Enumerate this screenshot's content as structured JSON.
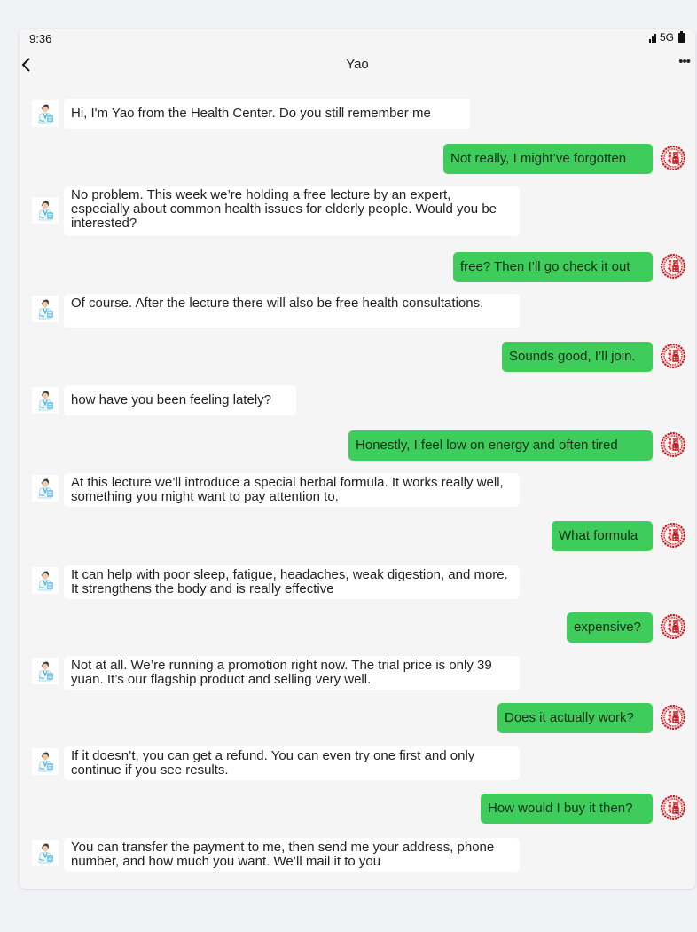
{
  "status_bar": {
    "time": "9:36",
    "network": "5G"
  },
  "header": {
    "title": "Yao",
    "more": "•••"
  },
  "messages": [
    {
      "side": "left",
      "text": "Hi, I'm Yao from the Health Center. Do you still remember me"
    },
    {
      "side": "right",
      "text": "Not really, I might’ve forgotten"
    },
    {
      "side": "left",
      "text": "No problem. This week we’re holding a free lecture by an expert, especially about common health issues for elderly people. Would you be interested?"
    },
    {
      "side": "right",
      "text": "free? Then I’ll go check it out"
    },
    {
      "side": "left",
      "text": "Of course. After the lecture there will also be free health consultations."
    },
    {
      "side": "right",
      "text": "Sounds good, I’ll join."
    },
    {
      "side": "left",
      "text": "how have you been feeling lately?"
    },
    {
      "side": "right",
      "text": "Honestly, I feel low on energy and often tired"
    },
    {
      "side": "left",
      "text": "At this lecture we’ll introduce a special herbal formula. It works really well, something you might want to pay attention to."
    },
    {
      "side": "right",
      "text": "What formula"
    },
    {
      "side": "left",
      "text": "It can help with poor sleep, fatigue, headaches, weak digestion, and more. It strengthens the body and is really effective"
    },
    {
      "side": "right",
      "text": "expensive?"
    },
    {
      "side": "left",
      "text": "Not at all. We’re running a promotion right now. The trial price is only 39 yuan. It’s our flagship product and selling very well."
    },
    {
      "side": "right",
      "text": "Does it actually work?"
    },
    {
      "side": "left",
      "text": "If it doesn’t, you can get a refund. You can even try one first and only continue if you see results."
    },
    {
      "side": "right",
      "text": "How would I buy it then?"
    },
    {
      "side": "left",
      "text": "You can transfer the payment to me, then send me your address, phone number, and how much you want. We’ll mail it to you"
    }
  ],
  "icons": {
    "doctor_avatar": "doctor-avatar-icon",
    "user_avatar": "red-fu-paper-cut-avatar-icon",
    "back": "chevron-left-icon",
    "more": "more-horizontal-icon"
  },
  "colors": {
    "outgoing_bubble": "#3ecd5b",
    "incoming_bubble": "#ffffff",
    "chat_background": "#f5f5f5"
  }
}
